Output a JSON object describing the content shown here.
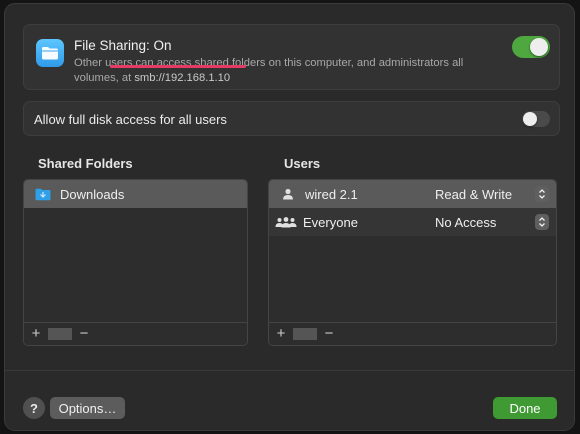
{
  "file_sharing": {
    "title": "File Sharing: On",
    "description_prefix": "Other users can access shared folders on this computer, and administrators all volumes, at ",
    "address": "smb://192.168.1.10",
    "toggle_state": "on"
  },
  "full_disk": {
    "label": "Allow full disk access for all users",
    "toggle_state": "off"
  },
  "shared_folders": {
    "title": "Shared Folders",
    "items": [
      {
        "name": "Downloads",
        "icon": "folder-icon"
      }
    ],
    "add_label": "+",
    "remove_label": "−"
  },
  "users": {
    "title": "Users",
    "items": [
      {
        "name": "wired 2.1",
        "icon": "user-icon",
        "permission": "Read & Write"
      },
      {
        "name": "Everyone",
        "icon": "group-icon",
        "permission": "No Access"
      }
    ],
    "add_label": "+",
    "remove_label": "−"
  },
  "footer": {
    "help_label": "?",
    "options_label": "Options…",
    "done_label": "Done"
  },
  "colors": {
    "accent_green": "#4ea83f",
    "underline_red": "#e33b63"
  }
}
